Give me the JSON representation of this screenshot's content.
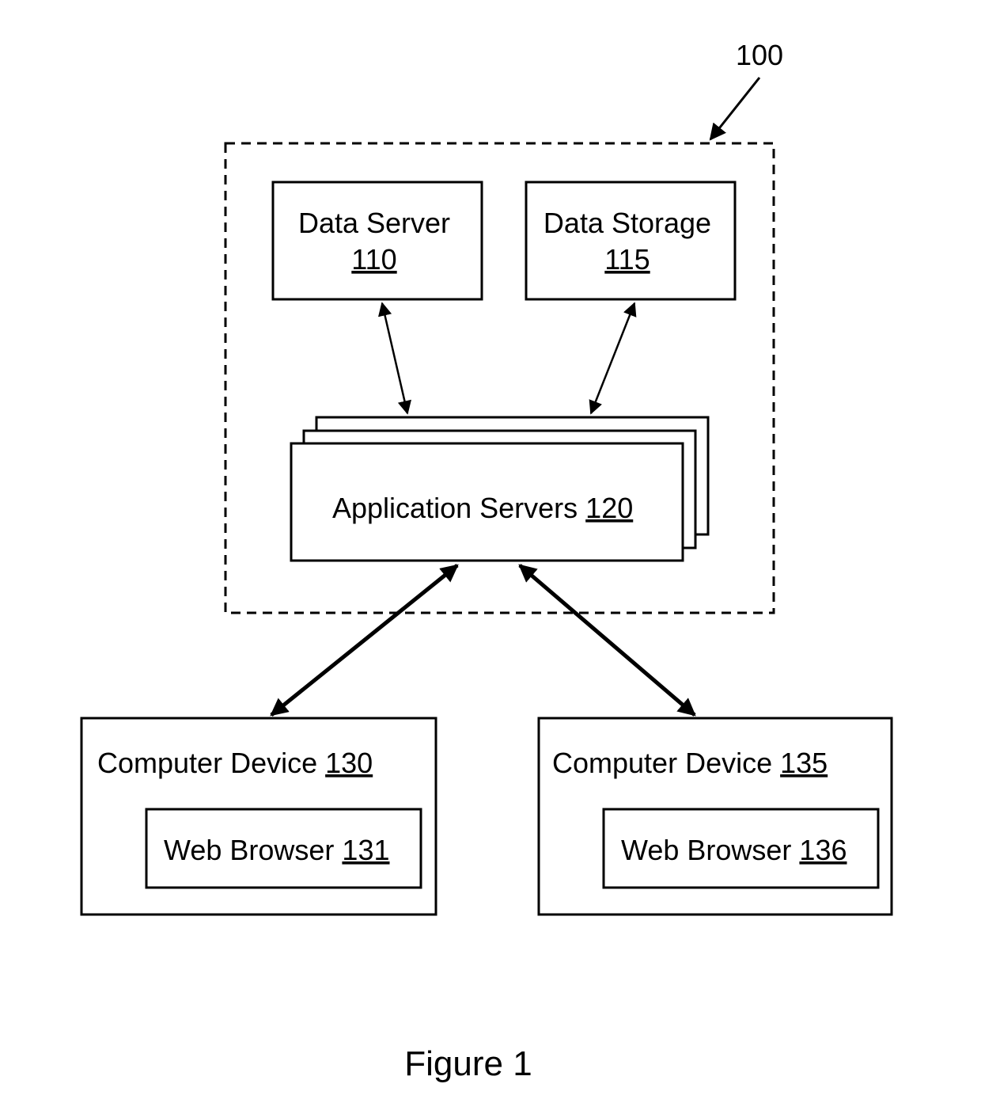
{
  "diagram": {
    "system_ref": "100",
    "nodes": {
      "data_server": {
        "label": "Data Server",
        "ref": "110"
      },
      "data_storage": {
        "label": "Data Storage",
        "ref": "115"
      },
      "application_servers": {
        "label": "Application Servers",
        "ref": "120"
      },
      "computer_device_a": {
        "label": "Computer Device",
        "ref": "130"
      },
      "web_browser_a": {
        "label": "Web Browser",
        "ref": "131"
      },
      "computer_device_b": {
        "label": "Computer Device",
        "ref": "135"
      },
      "web_browser_b": {
        "label": "Web Browser",
        "ref": "136"
      }
    },
    "edges": [
      {
        "from": "data_server",
        "to": "application_servers",
        "type": "bidirectional"
      },
      {
        "from": "data_storage",
        "to": "application_servers",
        "type": "bidirectional"
      },
      {
        "from": "application_servers",
        "to": "computer_device_a",
        "type": "bidirectional"
      },
      {
        "from": "application_servers",
        "to": "computer_device_b",
        "type": "bidirectional"
      }
    ],
    "caption": "Figure 1"
  }
}
